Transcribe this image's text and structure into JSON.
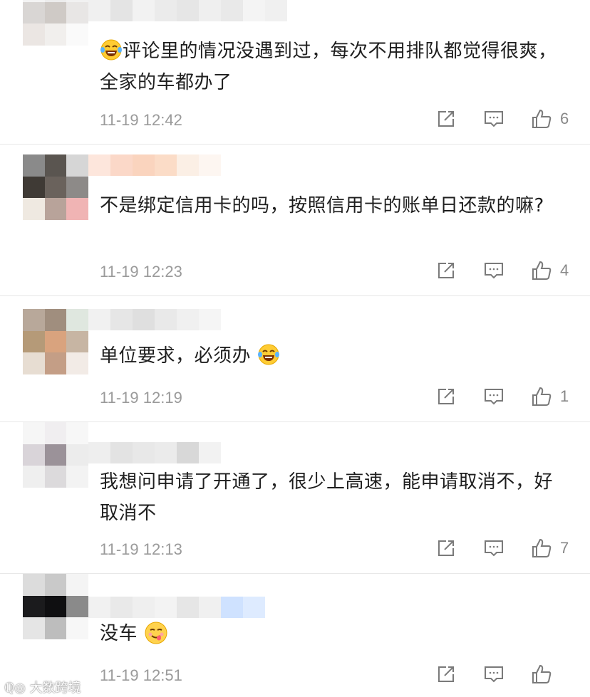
{
  "comments": [
    {
      "text": "评论里的情况没遇到过，每次不用排队都觉得很爽，全家的车都办了",
      "lead_emoji": "laugh-tears-icon",
      "time": "11-19 12:42",
      "likes": "6"
    },
    {
      "text": "不是绑定信用卡的吗，按照信用卡的账单日还款的嘛?",
      "time": "11-19 12:23",
      "likes": "4"
    },
    {
      "text": "单位要求，必须办",
      "trail_emoji": "laugh-tears-icon",
      "time": "11-19 12:19",
      "likes": "1"
    },
    {
      "text": "我想问申请了开通了，很少上高速，能申请取消不，好取消不",
      "time": "11-19 12:13",
      "likes": "7"
    },
    {
      "text": "没车",
      "trail_emoji": "yum-face-icon",
      "time": "11-19 12:51",
      "likes": ""
    }
  ],
  "watermark": "大数跨境",
  "colors": {
    "meta": "#9a9a9a",
    "text": "#1e1e1e",
    "divider": "#e8e8e8"
  }
}
